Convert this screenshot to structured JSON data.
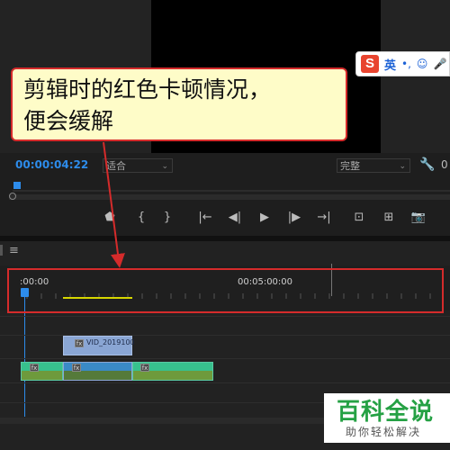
{
  "ime": {
    "logo": "S",
    "mode": "英",
    "punct": "•,",
    "emoji": "☺",
    "mic": "🎤"
  },
  "annotation": {
    "line1": "剪辑时的红色卡顿情况，",
    "line2": "便会缓解"
  },
  "monitor": {
    "timecode": "00:00:04:22",
    "fit": "适合",
    "quality": "完整",
    "page_num": "0"
  },
  "controls": [
    "⬟",
    "{",
    "}",
    "|←",
    "◀|",
    "▶",
    "|▶",
    "→|",
    "⊡",
    "⊞",
    "📷"
  ],
  "timeline": {
    "start_tc": ":00:00",
    "mid_tc": "00:05:00:00",
    "v2_clip_name": "VID_2019100"
  },
  "watermark": {
    "main": "百科全说",
    "sub": "助你轻松解决"
  },
  "colors": {
    "accent": "#2d8ceb",
    "highlight": "#d52b2b",
    "render_bar": "#d6d600"
  },
  "icons": {
    "wrench": "wrench-icon",
    "menu": "hamburger-icon",
    "fx": "fx-icon"
  }
}
